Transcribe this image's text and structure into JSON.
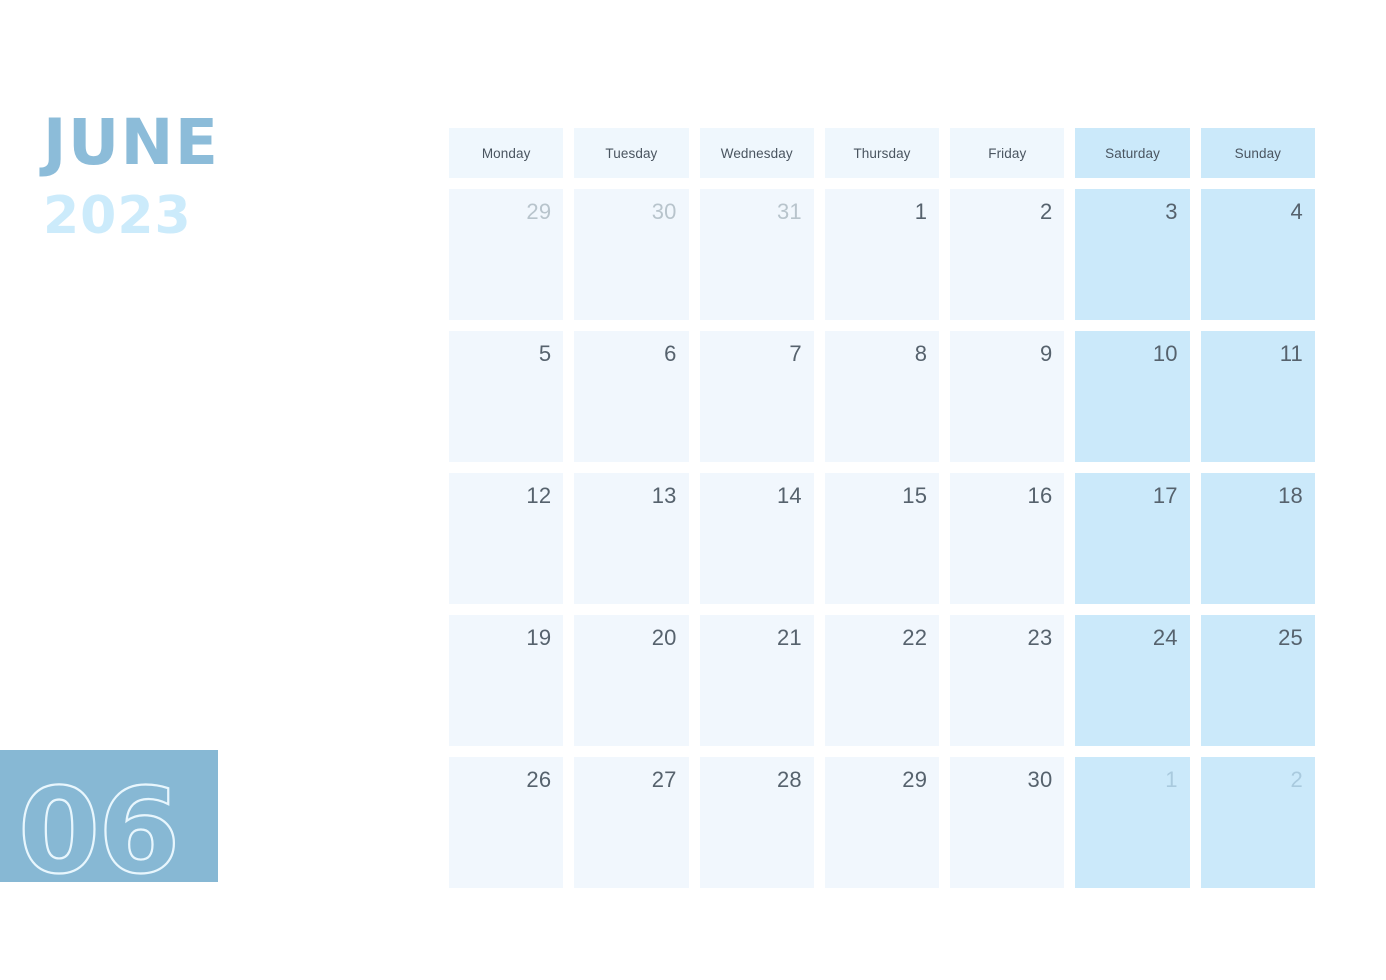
{
  "header": {
    "month_name": "JUNE",
    "year": "2023",
    "month_number": "06"
  },
  "colors": {
    "month_name": "#8cbcd9",
    "year": "#ccebfb",
    "month_block_bg": "#87b8d4",
    "month_block_outline": "#e8f6fd",
    "weekday_cell": "#f1f7fd",
    "weekend_cell": "#cbe9fa",
    "weekday_header": "#eff7fd",
    "weekend_header": "#cbe9fa",
    "day_number": "#56626d",
    "day_number_muted": "#b8c4cc",
    "page_bg": "#ffffff"
  },
  "weekdays": [
    {
      "label": "Monday",
      "weekend": false
    },
    {
      "label": "Tuesday",
      "weekend": false
    },
    {
      "label": "Wednesday",
      "weekend": false
    },
    {
      "label": "Thursday",
      "weekend": false
    },
    {
      "label": "Friday",
      "weekend": false
    },
    {
      "label": "Saturday",
      "weekend": true
    },
    {
      "label": "Sunday",
      "weekend": true
    }
  ],
  "weeks": [
    [
      {
        "num": "29",
        "other_month": true,
        "weekend": false
      },
      {
        "num": "30",
        "other_month": true,
        "weekend": false
      },
      {
        "num": "31",
        "other_month": true,
        "weekend": false
      },
      {
        "num": "1",
        "other_month": false,
        "weekend": false
      },
      {
        "num": "2",
        "other_month": false,
        "weekend": false
      },
      {
        "num": "3",
        "other_month": false,
        "weekend": true
      },
      {
        "num": "4",
        "other_month": false,
        "weekend": true
      }
    ],
    [
      {
        "num": "5",
        "other_month": false,
        "weekend": false
      },
      {
        "num": "6",
        "other_month": false,
        "weekend": false
      },
      {
        "num": "7",
        "other_month": false,
        "weekend": false
      },
      {
        "num": "8",
        "other_month": false,
        "weekend": false
      },
      {
        "num": "9",
        "other_month": false,
        "weekend": false
      },
      {
        "num": "10",
        "other_month": false,
        "weekend": true
      },
      {
        "num": "11",
        "other_month": false,
        "weekend": true
      }
    ],
    [
      {
        "num": "12",
        "other_month": false,
        "weekend": false
      },
      {
        "num": "13",
        "other_month": false,
        "weekend": false
      },
      {
        "num": "14",
        "other_month": false,
        "weekend": false
      },
      {
        "num": "15",
        "other_month": false,
        "weekend": false
      },
      {
        "num": "16",
        "other_month": false,
        "weekend": false
      },
      {
        "num": "17",
        "other_month": false,
        "weekend": true
      },
      {
        "num": "18",
        "other_month": false,
        "weekend": true
      }
    ],
    [
      {
        "num": "19",
        "other_month": false,
        "weekend": false
      },
      {
        "num": "20",
        "other_month": false,
        "weekend": false
      },
      {
        "num": "21",
        "other_month": false,
        "weekend": false
      },
      {
        "num": "22",
        "other_month": false,
        "weekend": false
      },
      {
        "num": "23",
        "other_month": false,
        "weekend": false
      },
      {
        "num": "24",
        "other_month": false,
        "weekend": true
      },
      {
        "num": "25",
        "other_month": false,
        "weekend": true
      }
    ],
    [
      {
        "num": "26",
        "other_month": false,
        "weekend": false
      },
      {
        "num": "27",
        "other_month": false,
        "weekend": false
      },
      {
        "num": "28",
        "other_month": false,
        "weekend": false
      },
      {
        "num": "29",
        "other_month": false,
        "weekend": false
      },
      {
        "num": "30",
        "other_month": false,
        "weekend": false
      },
      {
        "num": "1",
        "other_month": true,
        "weekend": true
      },
      {
        "num": "2",
        "other_month": true,
        "weekend": true
      }
    ]
  ]
}
